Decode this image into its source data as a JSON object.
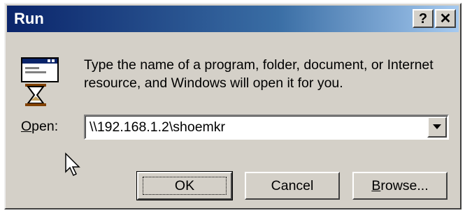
{
  "window": {
    "title": "Run",
    "help_glyph": "?",
    "close_glyph": "✕"
  },
  "icon": "run-program-icon",
  "description": "Type the name of a program, folder, document, or Internet resource, and Windows will open it for you.",
  "open_field": {
    "label_underlined": "O",
    "label_rest": "pen:",
    "value": "\\\\192.168.1.2\\shoemkr"
  },
  "buttons": {
    "ok": "OK",
    "cancel": "Cancel",
    "browse_underlined": "B",
    "browse_rest": "rowse..."
  },
  "colors": {
    "face": "#d4d0c8",
    "titlebar_start": "#0a246a",
    "titlebar_end": "#a6caf0"
  }
}
